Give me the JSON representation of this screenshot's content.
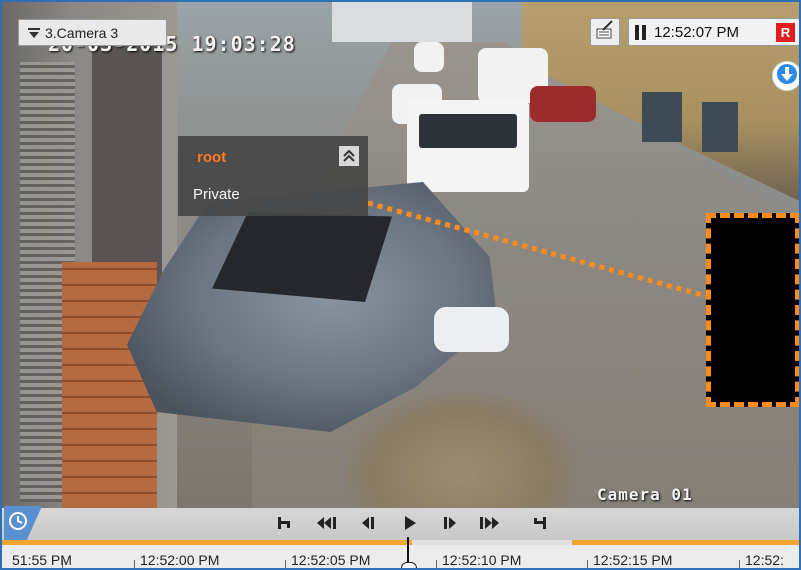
{
  "camera_selector": {
    "label": "3.Camera 3"
  },
  "overlay": {
    "osd_datetime": "20-03-2015 19:03:28",
    "osd_camera_name": "Camera 01"
  },
  "status": {
    "time": "12:52:07 PM",
    "record_badge": "R"
  },
  "user_popup": {
    "username": "root",
    "role": "Private"
  },
  "timeline": {
    "ticks": [
      "51:55 PM",
      "12:52:00 PM",
      "12:52:05 PM",
      "12:52:10 PM",
      "12:52:15 PM",
      "12:52:"
    ]
  },
  "colors": {
    "accent_orange": "#f3a531",
    "privacy_mask_border": "#ff8c1a",
    "record_red": "#e02020",
    "frame_blue": "#2f6fb5"
  },
  "icons": {
    "camera_selector": "triangle-down-menu-icon",
    "edit": "edit-note-icon",
    "pause": "pause-icon",
    "download": "arrow-down-circle-icon",
    "collapse": "double-chevron-up-icon",
    "timeline_clock": "clock-icon"
  },
  "controls": [
    {
      "name": "go-to-start-button",
      "icon": "skip-start-icon"
    },
    {
      "name": "fast-rewind-button",
      "icon": "fast-rewind-icon"
    },
    {
      "name": "step-back-button",
      "icon": "step-back-icon"
    },
    {
      "name": "play-button",
      "icon": "play-icon"
    },
    {
      "name": "step-forward-button",
      "icon": "step-forward-icon"
    },
    {
      "name": "fast-forward-button",
      "icon": "fast-forward-icon"
    },
    {
      "name": "go-to-end-button",
      "icon": "skip-end-icon"
    }
  ]
}
